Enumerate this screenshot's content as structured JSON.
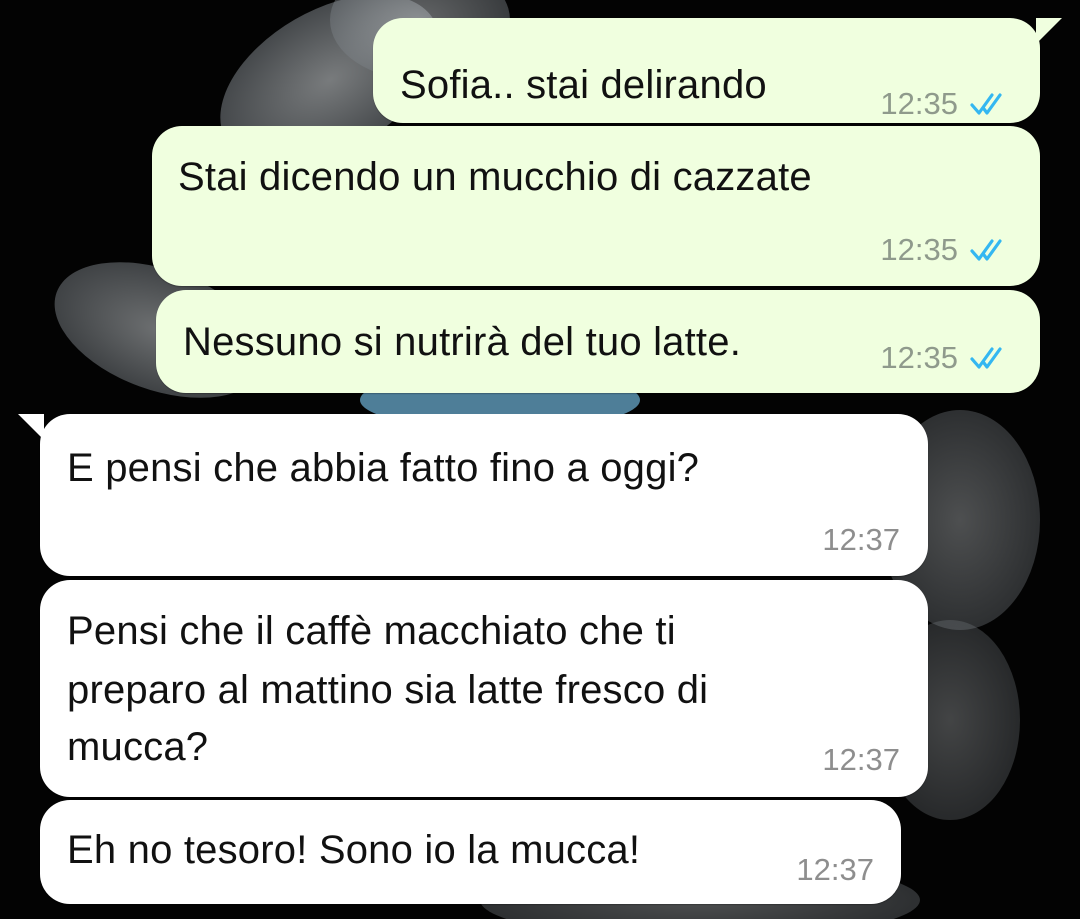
{
  "chat": {
    "messages": [
      {
        "direction": "outgoing",
        "text": "Sofia.. stai delirando",
        "time": "12:35",
        "status": "read-double-check-icon"
      },
      {
        "direction": "outgoing",
        "text": "Stai dicendo un mucchio di cazzate",
        "time": "12:35",
        "status": "read-double-check-icon"
      },
      {
        "direction": "outgoing",
        "text": "Nessuno si nutrirà del tuo latte.",
        "time": "12:35",
        "status": "read-double-check-icon"
      },
      {
        "direction": "incoming",
        "text": "E pensi che abbia fatto fino a oggi?",
        "time": "12:37"
      },
      {
        "direction": "incoming",
        "text_lines": [
          "Pensi che il caffè macchiato che ti",
          "preparo al mattino sia latte fresco di",
          "mucca?"
        ],
        "time": "12:37"
      },
      {
        "direction": "incoming",
        "text": "Eh no tesoro! Sono io la mucca!",
        "time": "12:37"
      }
    ]
  },
  "colors": {
    "background": "#030303",
    "outgoing_bubble": "#f0ffdf",
    "incoming_bubble": "#ffffff",
    "read_ticks": "#34b7f1",
    "timestamp": "#8f9a8c"
  }
}
